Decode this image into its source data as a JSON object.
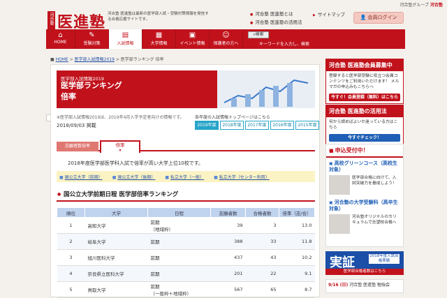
{
  "header": {
    "group": "河合塾グループ",
    "group_brand": "河合塾",
    "logo_small": "河合塾",
    "logo": "医進塾",
    "tagline": "河合塾 医進塾は最新の医学部入試・受験対策情報を発信する合格応援サイトです。",
    "links": [
      "河合塾 医進塾とは",
      "河合塾 医進塾の活用法"
    ],
    "sitemap": "サイトマップ",
    "login": "会員ログイン"
  },
  "nav": {
    "items": [
      {
        "label": "HOME",
        "icon": "home-icon"
      },
      {
        "label": "受験対策",
        "icon": "book-icon"
      },
      {
        "label": "入試情報",
        "icon": "document-icon"
      },
      {
        "label": "大学情報",
        "icon": "school-icon"
      },
      {
        "label": "イベント情報",
        "icon": "calendar-icon"
      },
      {
        "label": "保護者の方へ",
        "icon": "family-icon"
      }
    ],
    "search_button": "検索",
    "search_hint": "キーワードを入力し、検索"
  },
  "breadcrumb": [
    "HOME",
    "医学部入試情報2019",
    "医学部ランキング 倍率"
  ],
  "banner": {
    "line1": "医学部入試情報2019",
    "line2": "医学部ランキング",
    "line3": "倍率"
  },
  "note": "※医学部入試情報2019は、2019年4月入学予定者向けの情報です。",
  "toplink": "各年度の入試情報トップページはこちら",
  "date": "2018/09/03 掲載",
  "years": [
    "2019年度",
    "2018年度",
    "2017年度",
    "2016年度",
    "2015年度"
  ],
  "tabs": [
    "志願者数倍率",
    "倍率"
  ],
  "description": "2018年度医学部医学科入試で倍率が高い大学上位10校です。",
  "filters": [
    "国公立大学（前期）",
    "国公立大学（後期）",
    "私立大学（一般）",
    "私立大学（センター利用）"
  ],
  "section_title": "国公立大学前期日程 医学部倍率ランキング",
  "table": {
    "headers": [
      "順位",
      "大学",
      "日程",
      "志願者数",
      "合格者数",
      "倍率（志/合）"
    ],
    "rows": [
      {
        "rank": "1",
        "univ": "高知大学",
        "sched": "前期",
        "sched2": "（地域枠）",
        "app": "39",
        "pass": "3",
        "ratio": "13.0"
      },
      {
        "rank": "2",
        "univ": "岐阜大学",
        "sched": "前期",
        "sched2": "",
        "app": "388",
        "pass": "33",
        "ratio": "11.8"
      },
      {
        "rank": "3",
        "univ": "旭川医科大学",
        "sched": "前期",
        "sched2": "",
        "app": "437",
        "pass": "43",
        "ratio": "10.2"
      },
      {
        "rank": "4",
        "univ": "奈良県立医科大学",
        "sched": "前期",
        "sched2": "",
        "app": "201",
        "pass": "22",
        "ratio": "9.1"
      },
      {
        "rank": "5",
        "univ": "鳥取大学",
        "sched": "前期",
        "sched2": "（一般枠＋地域枠）",
        "app": "567",
        "pass": "65",
        "ratio": "8.7"
      }
    ]
  },
  "side": {
    "ad1": {
      "title": "河合塾 医進塾会員募集中",
      "body": "登録すると医学部受験に役立つ会員コンテンツをご利用いただけます！ メルマガの申込みもこちらへ",
      "cta": "今すぐ！会員登録（無料）はこちら"
    },
    "ad2": {
      "title": "河合塾 医進塾の活用法",
      "body": "何から読めばよいか迷っている方はこちら",
      "cta": "今すぐチェック！"
    },
    "box_title": "申込受付中！",
    "link1": "高校グリーンコース（高校生対象）",
    "text1": "医学部合格に向けて、入試突破力を養成しよう！",
    "link2": "河合塾の大学受験科（高卒生対象）",
    "text2": "河合塾オリジナルのカリキュラムで志望校合格へ",
    "jissho": "実証",
    "jissho_sub": "2018年度入試合格実績",
    "jissho_cta": "医学部合格者数はこちら",
    "event_date": "9/16 (日)",
    "event_text": "河合塾 医進塾 勉強会"
  }
}
